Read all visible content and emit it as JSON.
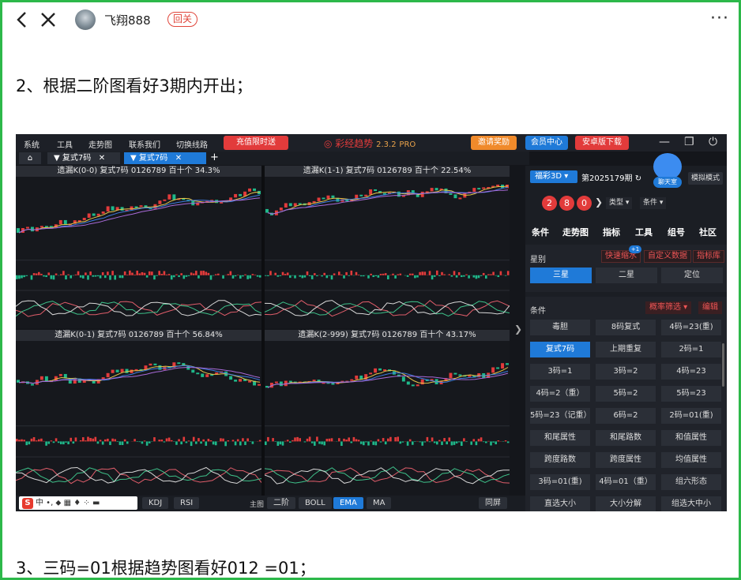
{
  "post": {
    "username": "飞翔888",
    "follow_label": "回关",
    "more_label": "···",
    "paragraph1": "2、根据二阶图看好3期内开出；",
    "paragraph2": "3、三码=01根据趋势图看好012 =01；"
  },
  "app": {
    "menu": [
      "系统",
      "工具",
      "走势图",
      "联系我们",
      "切换线路"
    ],
    "recharge_label": "充值限时送",
    "brand_name": "彩经趋势",
    "brand_version": "2.3.2",
    "brand_badge": "PRO",
    "invite_label": "邀请奖励",
    "member_label": "会员中心",
    "android_label": "安卓版下载",
    "tabs": [
      {
        "label": "复式7码",
        "close": "✕"
      },
      {
        "label": "复式7码",
        "close": "✕"
      }
    ],
    "add_tab": "+",
    "panels": [
      {
        "title": "遗漏K(0-0)  复式7码  0126789  百十个  34.3%"
      },
      {
        "title": "遗漏K(1-1)  复式7码  0126789  百十个  22.54%"
      },
      {
        "title": "遗漏K(0-1)  复式7码  0126789  百十个  56.84%"
      },
      {
        "title": "遗漏K(2-999)  复式7码  0126789  百十个  43.17%"
      }
    ],
    "bottom": {
      "ime_letter": "S",
      "ime_text": "中 •, ⬥ ▦ ♦ ⁘ ▬",
      "indicators": [
        "KDJ",
        "RSI"
      ],
      "main_label": "主图",
      "main_buttons": [
        "二阶",
        "BOLL",
        "EMA",
        "MA"
      ],
      "selected_main": "EMA",
      "sync_label": "同屏"
    },
    "right": {
      "lottery": "福彩3D",
      "period": "第2025179期",
      "chat_label": "聊天室",
      "sim_label": "模拟模式",
      "balls": [
        "2",
        "8",
        "0"
      ],
      "type_label": "类型",
      "cond_label": "条件",
      "nav": [
        "条件",
        "走势图",
        "指标",
        "工具",
        "组号",
        "社区"
      ],
      "star_label": "星别",
      "quick_label": "快速缩水",
      "quick_badge": "+1",
      "custom_label": "自定义数据",
      "index_lib_label": "指标库",
      "star_options": [
        "三星",
        "二星",
        "定位"
      ],
      "selected_star": "三星",
      "conditions_label": "条件",
      "prob_filter_label": "概率筛选",
      "edit_label": "编辑",
      "conditions": [
        [
          "毒胆",
          "8码复式",
          "4码=23(重)"
        ],
        [
          "复式7码",
          "上期重复",
          "2码=1"
        ],
        [
          "3码=1",
          "3码=2",
          "4码=23"
        ],
        [
          "4码=2（重）",
          "5码=2",
          "5码=23"
        ],
        [
          "5码=23（记重）",
          "6码=2",
          "2码=01(重)"
        ],
        [
          "和尾属性",
          "和尾路数",
          "和值属性"
        ],
        [
          "跨度路数",
          "跨度属性",
          "均值属性"
        ],
        [
          "3码=01(重)",
          "4码=01（重）",
          "组六形态"
        ],
        [
          "直选大小",
          "大小分解",
          "组选大中小"
        ]
      ],
      "selected_condition": "复式7码"
    }
  },
  "colors": {
    "frame": "#2db84a",
    "accent_blue": "#1f7ad8",
    "up_red": "#e23b3b",
    "down_green": "#1fb88a"
  }
}
